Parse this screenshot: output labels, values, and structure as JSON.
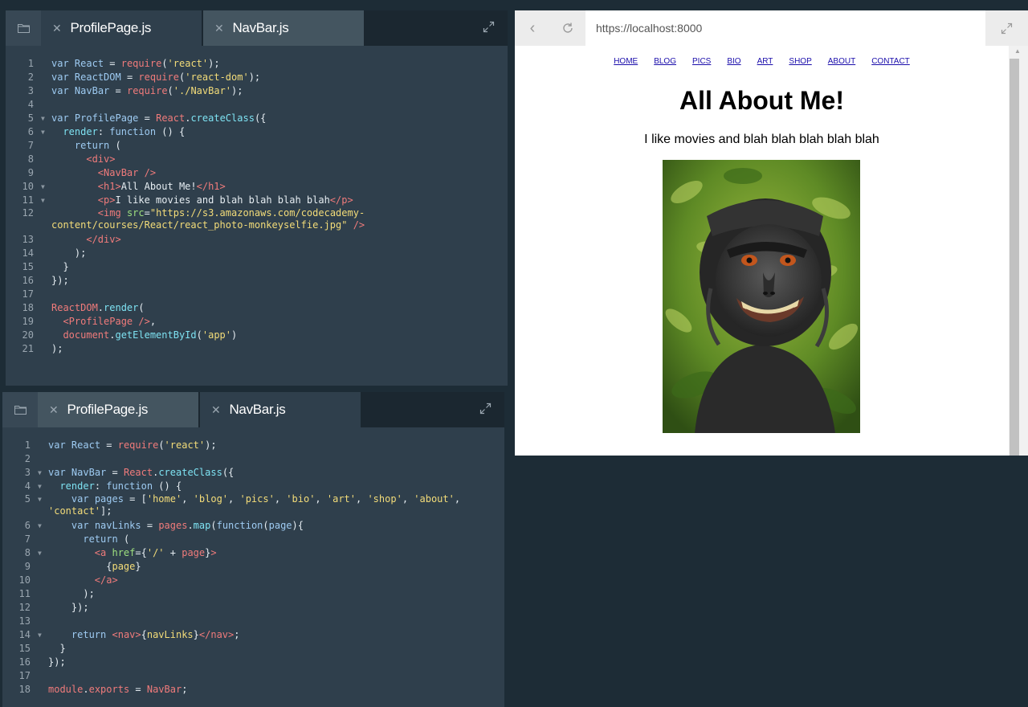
{
  "editor_top": {
    "tabs": [
      {
        "label": "ProfilePage.js",
        "active": true
      },
      {
        "label": "NavBar.js",
        "active": false
      }
    ],
    "lines": [
      {
        "n": "1",
        "html": "<span class='kw'>var</span> <span class='kw'>React</span> = <span class='obj'>require</span>(<span class='str'>'react'</span>);"
      },
      {
        "n": "2",
        "html": "<span class='kw'>var</span> <span class='kw'>ReactDOM</span> = <span class='obj'>require</span>(<span class='str'>'react-dom'</span>);"
      },
      {
        "n": "3",
        "html": "<span class='kw'>var</span> <span class='kw'>NavBar</span> = <span class='obj'>require</span>(<span class='str'>'./NavBar'</span>);"
      },
      {
        "n": "4",
        "html": ""
      },
      {
        "n": "5",
        "fold": true,
        "html": "<span class='kw'>var</span> <span class='kw'>ProfilePage</span> = <span class='obj'>React</span>.<span class='fn'>createClass</span>({"
      },
      {
        "n": "6",
        "fold": true,
        "html": "  <span class='fn'>render</span>: <span class='kw'>function</span> () {"
      },
      {
        "n": "7",
        "html": "    <span class='kw'>return</span> ("
      },
      {
        "n": "8",
        "html": "      <span class='tag'>&lt;div&gt;</span>"
      },
      {
        "n": "9",
        "html": "        <span class='tag'>&lt;NavBar /&gt;</span>"
      },
      {
        "n": "10",
        "fold": true,
        "html": "        <span class='tag'>&lt;h1&gt;</span>All About Me!<span class='tag'>&lt;/h1&gt;</span>"
      },
      {
        "n": "11",
        "fold": true,
        "html": "        <span class='tag'>&lt;p&gt;</span>I like movies and blah blah blah blah<span class='tag'>&lt;/p&gt;</span>"
      },
      {
        "n": "12",
        "wrap": true,
        "html": "        <span class='tag'>&lt;img</span> <span class='attr'>src</span>=<span class='str'>\"https://s3.amazonaws.com/codecademy-content/courses/React/react_photo-monkeyselfie.jpg\"</span> <span class='tag'>/&gt;</span>"
      },
      {
        "n": "13",
        "html": "      <span class='tag'>&lt;/div&gt;</span>"
      },
      {
        "n": "14",
        "html": "    );"
      },
      {
        "n": "15",
        "html": "  }"
      },
      {
        "n": "16",
        "html": "});"
      },
      {
        "n": "17",
        "html": ""
      },
      {
        "n": "18",
        "html": "<span class='obj'>ReactDOM</span>.<span class='fn'>render</span>("
      },
      {
        "n": "19",
        "html": "  <span class='tag'>&lt;ProfilePage /&gt;</span>,"
      },
      {
        "n": "20",
        "html": "  <span class='obj'>document</span>.<span class='fn'>getElementById</span>(<span class='str'>'app'</span>)"
      },
      {
        "n": "21",
        "html": ");"
      }
    ]
  },
  "editor_bottom": {
    "tabs": [
      {
        "label": "ProfilePage.js",
        "active": false
      },
      {
        "label": "NavBar.js",
        "active": true
      }
    ],
    "lines": [
      {
        "n": "1",
        "html": "<span class='kw'>var</span> <span class='kw'>React</span> = <span class='obj'>require</span>(<span class='str'>'react'</span>);"
      },
      {
        "n": "2",
        "html": ""
      },
      {
        "n": "3",
        "fold": true,
        "html": "<span class='kw'>var</span> <span class='kw'>NavBar</span> = <span class='obj'>React</span>.<span class='fn'>createClass</span>({"
      },
      {
        "n": "4",
        "fold": true,
        "html": "  <span class='fn'>render</span>: <span class='kw'>function</span> () {"
      },
      {
        "n": "5",
        "fold": true,
        "wrap": true,
        "html": "    <span class='kw'>var</span> <span class='kw'>pages</span> = [<span class='str'>'home'</span>, <span class='str'>'blog'</span>, <span class='str'>'pics'</span>, <span class='str'>'bio'</span>, <span class='str'>'art'</span>, <span class='str'>'shop'</span>, <span class='str'>'about'</span>, <span class='str'>'contact'</span>];"
      },
      {
        "n": "6",
        "fold": true,
        "html": "    <span class='kw'>var</span> <span class='kw'>navLinks</span> = <span class='obj'>pages</span>.<span class='fn'>map</span>(<span class='kw'>function</span>(<span class='kw'>page</span>){"
      },
      {
        "n": "7",
        "html": "      <span class='kw'>return</span> ("
      },
      {
        "n": "8",
        "fold": true,
        "html": "        <span class='tag'>&lt;a</span> <span class='attr'>href</span>={<span class='str'>'/'</span> + <span class='obj'>page</span>}<span class='tag'>&gt;</span>"
      },
      {
        "n": "9",
        "html": "          {<span class='str'>page</span>}"
      },
      {
        "n": "10",
        "html": "        <span class='tag'>&lt;/a&gt;</span>"
      },
      {
        "n": "11",
        "html": "      );"
      },
      {
        "n": "12",
        "html": "    });"
      },
      {
        "n": "13",
        "html": ""
      },
      {
        "n": "14",
        "fold": true,
        "html": "    <span class='kw'>return</span> <span class='tag'>&lt;nav&gt;</span>{<span class='str'>navLinks</span>}<span class='tag'>&lt;/nav&gt;</span>;"
      },
      {
        "n": "15",
        "html": "  }"
      },
      {
        "n": "16",
        "html": "});"
      },
      {
        "n": "17",
        "html": ""
      },
      {
        "n": "18",
        "html": "<span class='obj'>module</span>.<span class='obj'>exports</span> = <span class='obj'>NavBar</span>;"
      }
    ]
  },
  "browser": {
    "url": "https://localhost:8000",
    "nav_links": [
      "HOME",
      "BLOG",
      "PICS",
      "BIO",
      "ART",
      "SHOP",
      "ABOUT",
      "CONTACT"
    ],
    "heading": "All About Me!",
    "paragraph": "I like movies and blah blah blah blah blah"
  }
}
